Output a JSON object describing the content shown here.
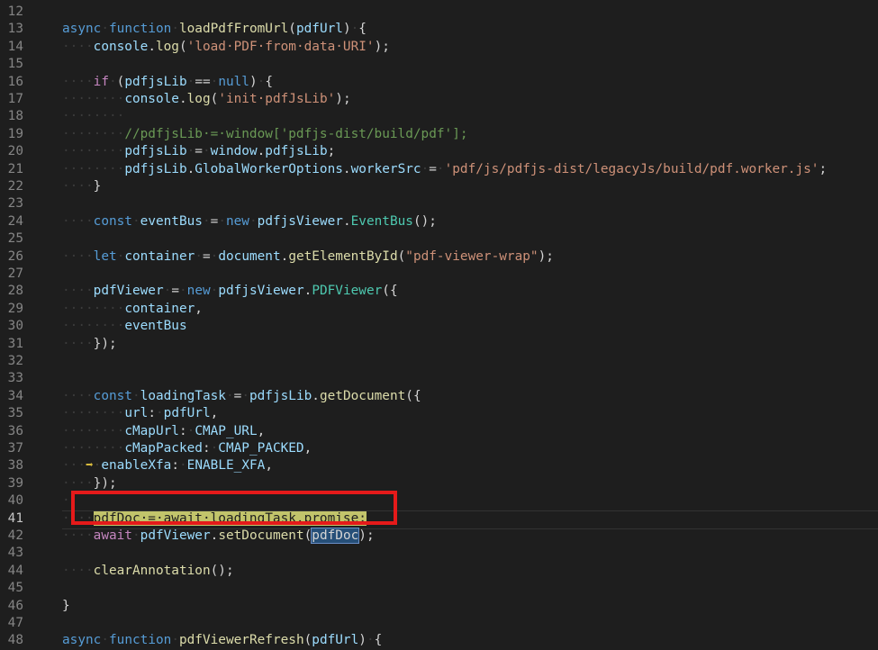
{
  "editor": {
    "lines": [
      {
        "n": "12",
        "segs": []
      },
      {
        "n": "13",
        "segs": [
          [
            "kw",
            "async"
          ],
          [
            "ws",
            "·"
          ],
          [
            "kw",
            "function"
          ],
          [
            "ws",
            "·"
          ],
          [
            "fn",
            "loadPdfFromUrl"
          ],
          [
            "pn",
            "("
          ],
          [
            "var",
            "pdfUrl"
          ],
          [
            "pn",
            ")"
          ],
          [
            "ws",
            "·"
          ],
          [
            "pn",
            "{"
          ]
        ]
      },
      {
        "n": "14",
        "segs": [
          [
            "ws",
            "····"
          ],
          [
            "var",
            "console"
          ],
          [
            "pn",
            "."
          ],
          [
            "fn",
            "log"
          ],
          [
            "pn",
            "("
          ],
          [
            "str",
            "'load·PDF·from·data·URI'"
          ],
          [
            "pn",
            ");"
          ]
        ]
      },
      {
        "n": "15",
        "segs": []
      },
      {
        "n": "16",
        "segs": [
          [
            "ws",
            "····"
          ],
          [
            "ctl",
            "if"
          ],
          [
            "ws",
            "·"
          ],
          [
            "pn",
            "("
          ],
          [
            "var",
            "pdfjsLib"
          ],
          [
            "ws",
            "·"
          ],
          [
            "pn",
            "=="
          ],
          [
            "ws",
            "·"
          ],
          [
            "kw",
            "null"
          ],
          [
            "pn",
            ")"
          ],
          [
            "ws",
            "·"
          ],
          [
            "pn",
            "{"
          ]
        ]
      },
      {
        "n": "17",
        "segs": [
          [
            "ws",
            "········"
          ],
          [
            "var",
            "console"
          ],
          [
            "pn",
            "."
          ],
          [
            "fn",
            "log"
          ],
          [
            "pn",
            "("
          ],
          [
            "str",
            "'init·pdfJsLib'"
          ],
          [
            "pn",
            ");"
          ]
        ]
      },
      {
        "n": "18",
        "segs": [
          [
            "ws",
            "········"
          ]
        ]
      },
      {
        "n": "19",
        "segs": [
          [
            "ws",
            "········"
          ],
          [
            "cmt",
            "//pdfjsLib·=·window['pdfjs-dist/build/pdf'];"
          ]
        ]
      },
      {
        "n": "20",
        "segs": [
          [
            "ws",
            "········"
          ],
          [
            "var",
            "pdfjsLib"
          ],
          [
            "ws",
            "·"
          ],
          [
            "pn",
            "="
          ],
          [
            "ws",
            "·"
          ],
          [
            "var",
            "window"
          ],
          [
            "pn",
            "."
          ],
          [
            "var",
            "pdfjsLib"
          ],
          [
            "pn",
            ";"
          ]
        ]
      },
      {
        "n": "21",
        "segs": [
          [
            "ws",
            "········"
          ],
          [
            "var",
            "pdfjsLib"
          ],
          [
            "pn",
            "."
          ],
          [
            "var",
            "GlobalWorkerOptions"
          ],
          [
            "pn",
            "."
          ],
          [
            "var",
            "workerSrc"
          ],
          [
            "ws",
            "·"
          ],
          [
            "pn",
            "="
          ],
          [
            "ws",
            "·"
          ],
          [
            "str",
            "'pdf/js/pdfjs-dist/legacyJs/build/pdf.worker.js'"
          ],
          [
            "pn",
            ";"
          ]
        ]
      },
      {
        "n": "22",
        "segs": [
          [
            "ws",
            "····"
          ],
          [
            "pn",
            "}"
          ]
        ]
      },
      {
        "n": "23",
        "segs": []
      },
      {
        "n": "24",
        "segs": [
          [
            "ws",
            "····"
          ],
          [
            "kw",
            "const"
          ],
          [
            "ws",
            "·"
          ],
          [
            "var",
            "eventBus"
          ],
          [
            "ws",
            "·"
          ],
          [
            "pn",
            "="
          ],
          [
            "ws",
            "·"
          ],
          [
            "kw",
            "new"
          ],
          [
            "ws",
            "·"
          ],
          [
            "var",
            "pdfjsViewer"
          ],
          [
            "pn",
            "."
          ],
          [
            "cls",
            "EventBus"
          ],
          [
            "pn",
            "();"
          ]
        ]
      },
      {
        "n": "25",
        "segs": []
      },
      {
        "n": "26",
        "segs": [
          [
            "ws",
            "····"
          ],
          [
            "kw",
            "let"
          ],
          [
            "ws",
            "·"
          ],
          [
            "var",
            "container"
          ],
          [
            "ws",
            "·"
          ],
          [
            "pn",
            "="
          ],
          [
            "ws",
            "·"
          ],
          [
            "var",
            "document"
          ],
          [
            "pn",
            "."
          ],
          [
            "fn",
            "getElementById"
          ],
          [
            "pn",
            "("
          ],
          [
            "str",
            "\"pdf-viewer-wrap\""
          ],
          [
            "pn",
            ");"
          ]
        ]
      },
      {
        "n": "27",
        "segs": []
      },
      {
        "n": "28",
        "segs": [
          [
            "ws",
            "····"
          ],
          [
            "var",
            "pdfViewer"
          ],
          [
            "ws",
            "·"
          ],
          [
            "pn",
            "="
          ],
          [
            "ws",
            "·"
          ],
          [
            "kw",
            "new"
          ],
          [
            "ws",
            "·"
          ],
          [
            "var",
            "pdfjsViewer"
          ],
          [
            "pn",
            "."
          ],
          [
            "cls",
            "PDFViewer"
          ],
          [
            "pn",
            "({"
          ]
        ]
      },
      {
        "n": "29",
        "segs": [
          [
            "ws",
            "········"
          ],
          [
            "var",
            "container"
          ],
          [
            "pn",
            ","
          ]
        ]
      },
      {
        "n": "30",
        "segs": [
          [
            "ws",
            "········"
          ],
          [
            "var",
            "eventBus"
          ]
        ]
      },
      {
        "n": "31",
        "segs": [
          [
            "ws",
            "····"
          ],
          [
            "pn",
            "});"
          ]
        ]
      },
      {
        "n": "32",
        "segs": []
      },
      {
        "n": "33",
        "segs": []
      },
      {
        "n": "34",
        "segs": [
          [
            "ws",
            "····"
          ],
          [
            "kw",
            "const"
          ],
          [
            "ws",
            "·"
          ],
          [
            "var",
            "loadingTask"
          ],
          [
            "ws",
            "·"
          ],
          [
            "pn",
            "="
          ],
          [
            "ws",
            "·"
          ],
          [
            "var",
            "pdfjsLib"
          ],
          [
            "pn",
            "."
          ],
          [
            "fn",
            "getDocument"
          ],
          [
            "pn",
            "({"
          ]
        ]
      },
      {
        "n": "35",
        "segs": [
          [
            "ws",
            "········"
          ],
          [
            "var",
            "url"
          ],
          [
            "pn",
            ":"
          ],
          [
            "ws",
            "·"
          ],
          [
            "var",
            "pdfUrl"
          ],
          [
            "pn",
            ","
          ]
        ]
      },
      {
        "n": "36",
        "segs": [
          [
            "ws",
            "········"
          ],
          [
            "var",
            "cMapUrl"
          ],
          [
            "pn",
            ":"
          ],
          [
            "ws",
            "·"
          ],
          [
            "var",
            "CMAP_URL"
          ],
          [
            "pn",
            ","
          ]
        ]
      },
      {
        "n": "37",
        "segs": [
          [
            "ws",
            "········"
          ],
          [
            "var",
            "cMapPacked"
          ],
          [
            "pn",
            ":"
          ],
          [
            "ws",
            "·"
          ],
          [
            "var",
            "CMAP_PACKED"
          ],
          [
            "pn",
            ","
          ]
        ]
      },
      {
        "n": "38",
        "segs": [
          [
            "ws",
            "···"
          ],
          [
            "bp-arrow",
            "➡"
          ],
          [
            "ws",
            "·"
          ],
          [
            "var",
            "enableXfa"
          ],
          [
            "pn",
            ":"
          ],
          [
            "ws",
            "·"
          ],
          [
            "var",
            "ENABLE_XFA"
          ],
          [
            "pn",
            ","
          ]
        ]
      },
      {
        "n": "39",
        "segs": [
          [
            "ws",
            "····"
          ],
          [
            "pn",
            "});"
          ]
        ]
      },
      {
        "n": "40",
        "segs": [
          [
            "ws",
            "··"
          ]
        ]
      },
      {
        "n": "41",
        "segs": [
          [
            "ws",
            "····"
          ],
          [
            "hl-yellow",
            "pdfDoc·=·await·loadingTask.promise;"
          ]
        ]
      },
      {
        "n": "42",
        "segs": [
          [
            "ws",
            "····"
          ],
          [
            "ctl",
            "await"
          ],
          [
            "ws",
            "·"
          ],
          [
            "var",
            "pdfViewer"
          ],
          [
            "pn",
            "."
          ],
          [
            "fn",
            "setDocument"
          ],
          [
            "pn",
            "("
          ],
          [
            "word-box",
            "pdfDoc"
          ],
          [
            "pn",
            ");"
          ]
        ]
      },
      {
        "n": "43",
        "segs": []
      },
      {
        "n": "44",
        "segs": [
          [
            "ws",
            "····"
          ],
          [
            "fn",
            "clearAnnotation"
          ],
          [
            "pn",
            "();"
          ]
        ]
      },
      {
        "n": "45",
        "segs": []
      },
      {
        "n": "46",
        "segs": [
          [
            "pn",
            "}"
          ]
        ]
      },
      {
        "n": "47",
        "segs": []
      },
      {
        "n": "48",
        "segs": [
          [
            "kw",
            "async"
          ],
          [
            "ws",
            "·"
          ],
          [
            "kw",
            "function"
          ],
          [
            "ws",
            "·"
          ],
          [
            "fn",
            "pdfViewerRefresh"
          ],
          [
            "pn",
            "("
          ],
          [
            "var",
            "pdfUrl"
          ],
          [
            "pn",
            ")"
          ],
          [
            "ws",
            "·"
          ],
          [
            "pn",
            "{"
          ]
        ]
      }
    ],
    "active_line": "41",
    "accent_colors": {
      "highlight": "#c2c46b",
      "annotation_box": "#e51a1a",
      "selection": "#264f78"
    }
  }
}
